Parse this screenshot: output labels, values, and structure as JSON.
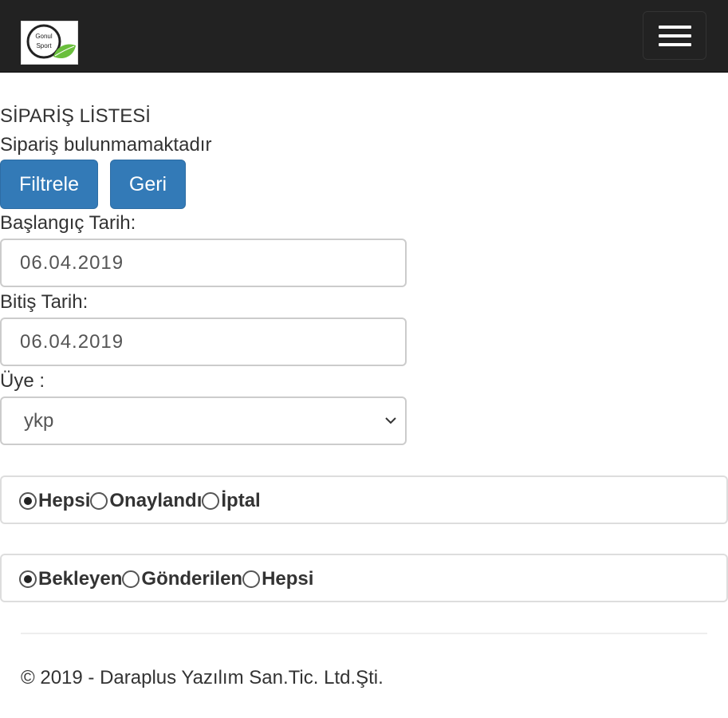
{
  "navbar": {
    "logo_text_line1": "Gonul",
    "logo_text_line2": "Sport",
    "logo_icon": "leaf-logo-icon",
    "menu_icon": "hamburger-menu-icon"
  },
  "page": {
    "title": "SİPARİŞ LİSTESİ",
    "empty_message": "Sipariş bulunmamaktadır"
  },
  "buttons": {
    "filter_label": "Filtrele",
    "back_label": "Geri"
  },
  "form": {
    "start_label": "Başlangıç Tarih:",
    "start_value": "06.04.2019",
    "end_label": "Bitiş Tarih:",
    "end_value": "06.04.2019",
    "member_label": "Üye :",
    "member_selected": "ykp"
  },
  "approval_filter": {
    "options": [
      "Hepsi",
      "Onaylandı",
      "İptal"
    ],
    "selected_index": 0
  },
  "shipping_filter": {
    "options": [
      "Bekleyen",
      "Gönderilen",
      "Hepsi"
    ],
    "selected_index": 0
  },
  "footer": {
    "copyright": "© 2019 - Daraplus Yazılım San.Tic. Ltd.Şti."
  },
  "colors": {
    "navbar_bg": "#222222",
    "primary_button": "#337ab7",
    "logo_leaf": "#6abf3c"
  }
}
